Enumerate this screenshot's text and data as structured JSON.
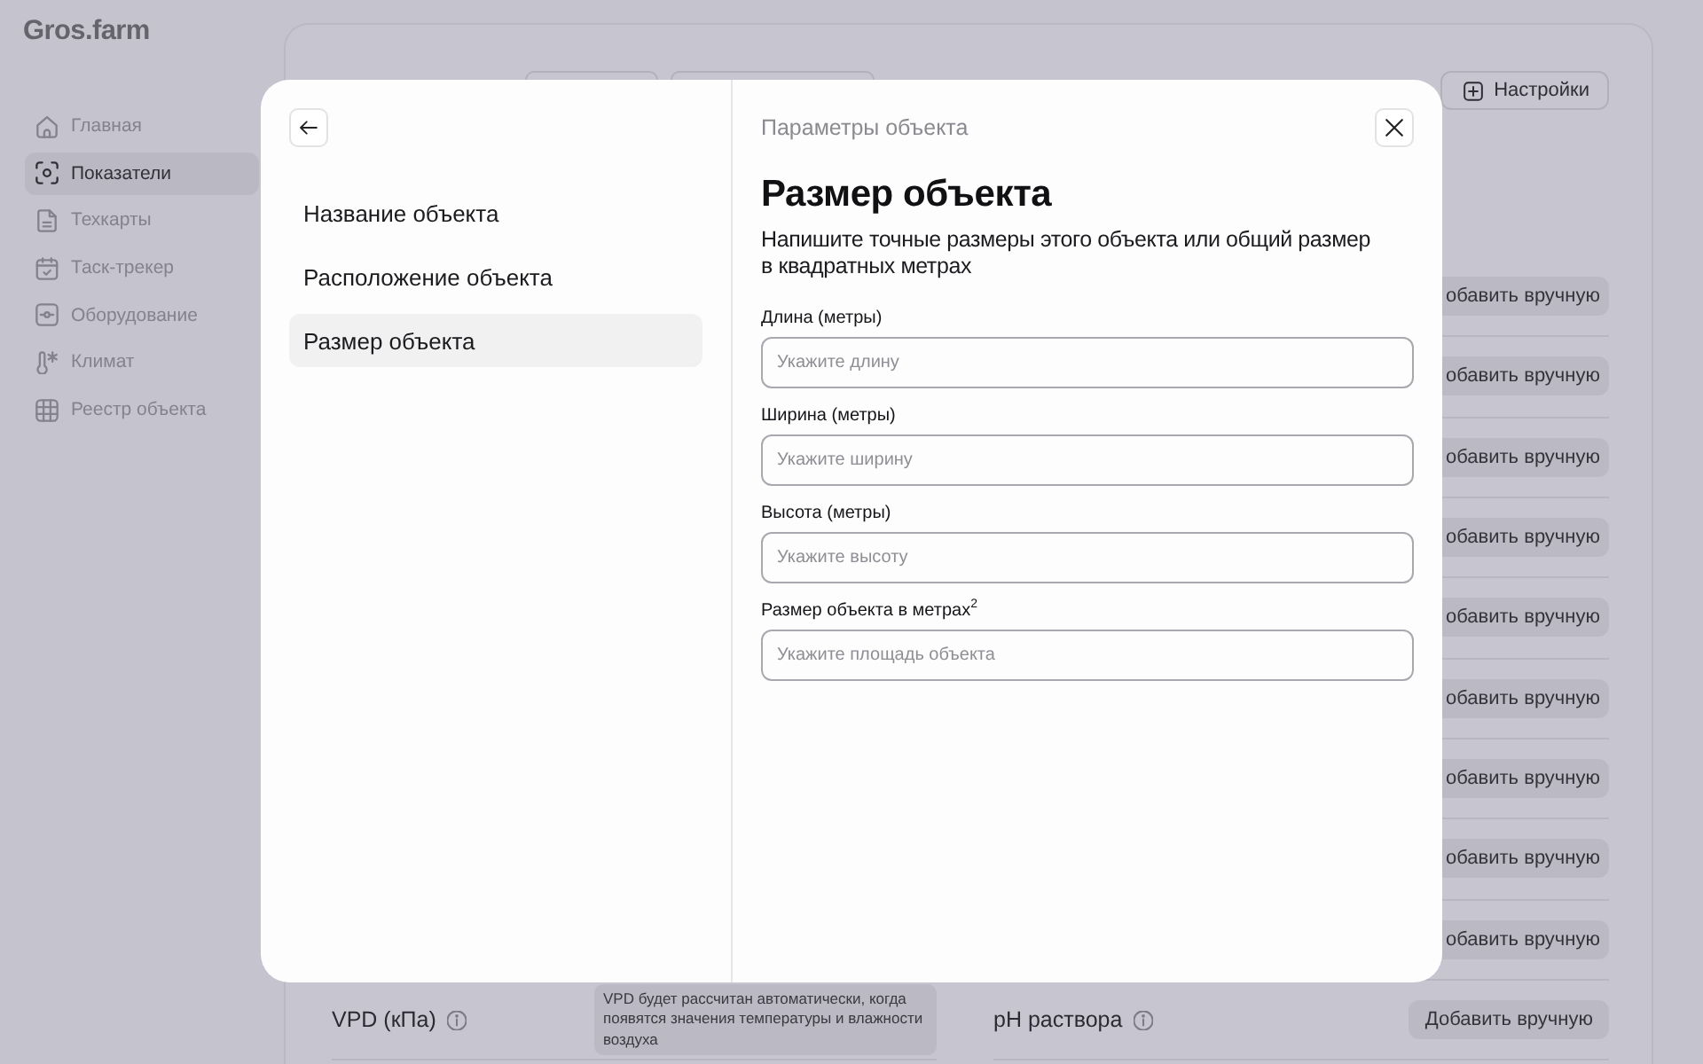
{
  "sidebar": {
    "logo": "Gros.farm",
    "items": [
      {
        "label": "Главная",
        "selected": false
      },
      {
        "label": "Показатели",
        "selected": true
      },
      {
        "label": "Техкарты",
        "selected": false
      },
      {
        "label": "Таск-трекер",
        "selected": false
      },
      {
        "label": "Оборудование",
        "selected": false
      },
      {
        "label": "Климат",
        "selected": false
      },
      {
        "label": "Реестр объекта",
        "selected": false
      }
    ]
  },
  "toolbar": {
    "settings_button": "Настройки"
  },
  "metrics": {
    "left_rows": [
      {
        "label": "VPD (кПа)",
        "note": "VPD будет рассчитан автоматически, когда появятся значения температуры и влажности воздуха"
      }
    ],
    "right_rows": [
      {
        "button": "обавить вручную"
      },
      {
        "button": "обавить вручную"
      },
      {
        "button": "обавить вручную"
      },
      {
        "button": "обавить вручную"
      },
      {
        "button": "обавить вручную"
      },
      {
        "button": "обавить вручную"
      },
      {
        "button": "обавить вручную"
      },
      {
        "button": "обавить вручную"
      },
      {
        "button": "обавить вручную"
      },
      {
        "label": "pH раствора",
        "button": "Добавить вручную"
      }
    ]
  },
  "dialog": {
    "section": "Параметры объекта",
    "title": "Размер объекта",
    "description": "Напишите точные размеры этого объекта или общий размер в квадратных метрах",
    "steps": [
      {
        "label": "Название объекта",
        "selected": false
      },
      {
        "label": "Расположение объекта",
        "selected": false
      },
      {
        "label": "Размер объекта",
        "selected": true
      }
    ],
    "fields": [
      {
        "label": "Длина (метры)",
        "placeholder": "Укажите длину"
      },
      {
        "label": "Ширина (метры)",
        "placeholder": "Укажите ширину"
      },
      {
        "label": "Высота (метры)",
        "placeholder": "Укажите высоту"
      },
      {
        "label": "Размер объекта в метрах$^{2}$",
        "placeholder": "Укажите площадь объекта"
      }
    ]
  }
}
